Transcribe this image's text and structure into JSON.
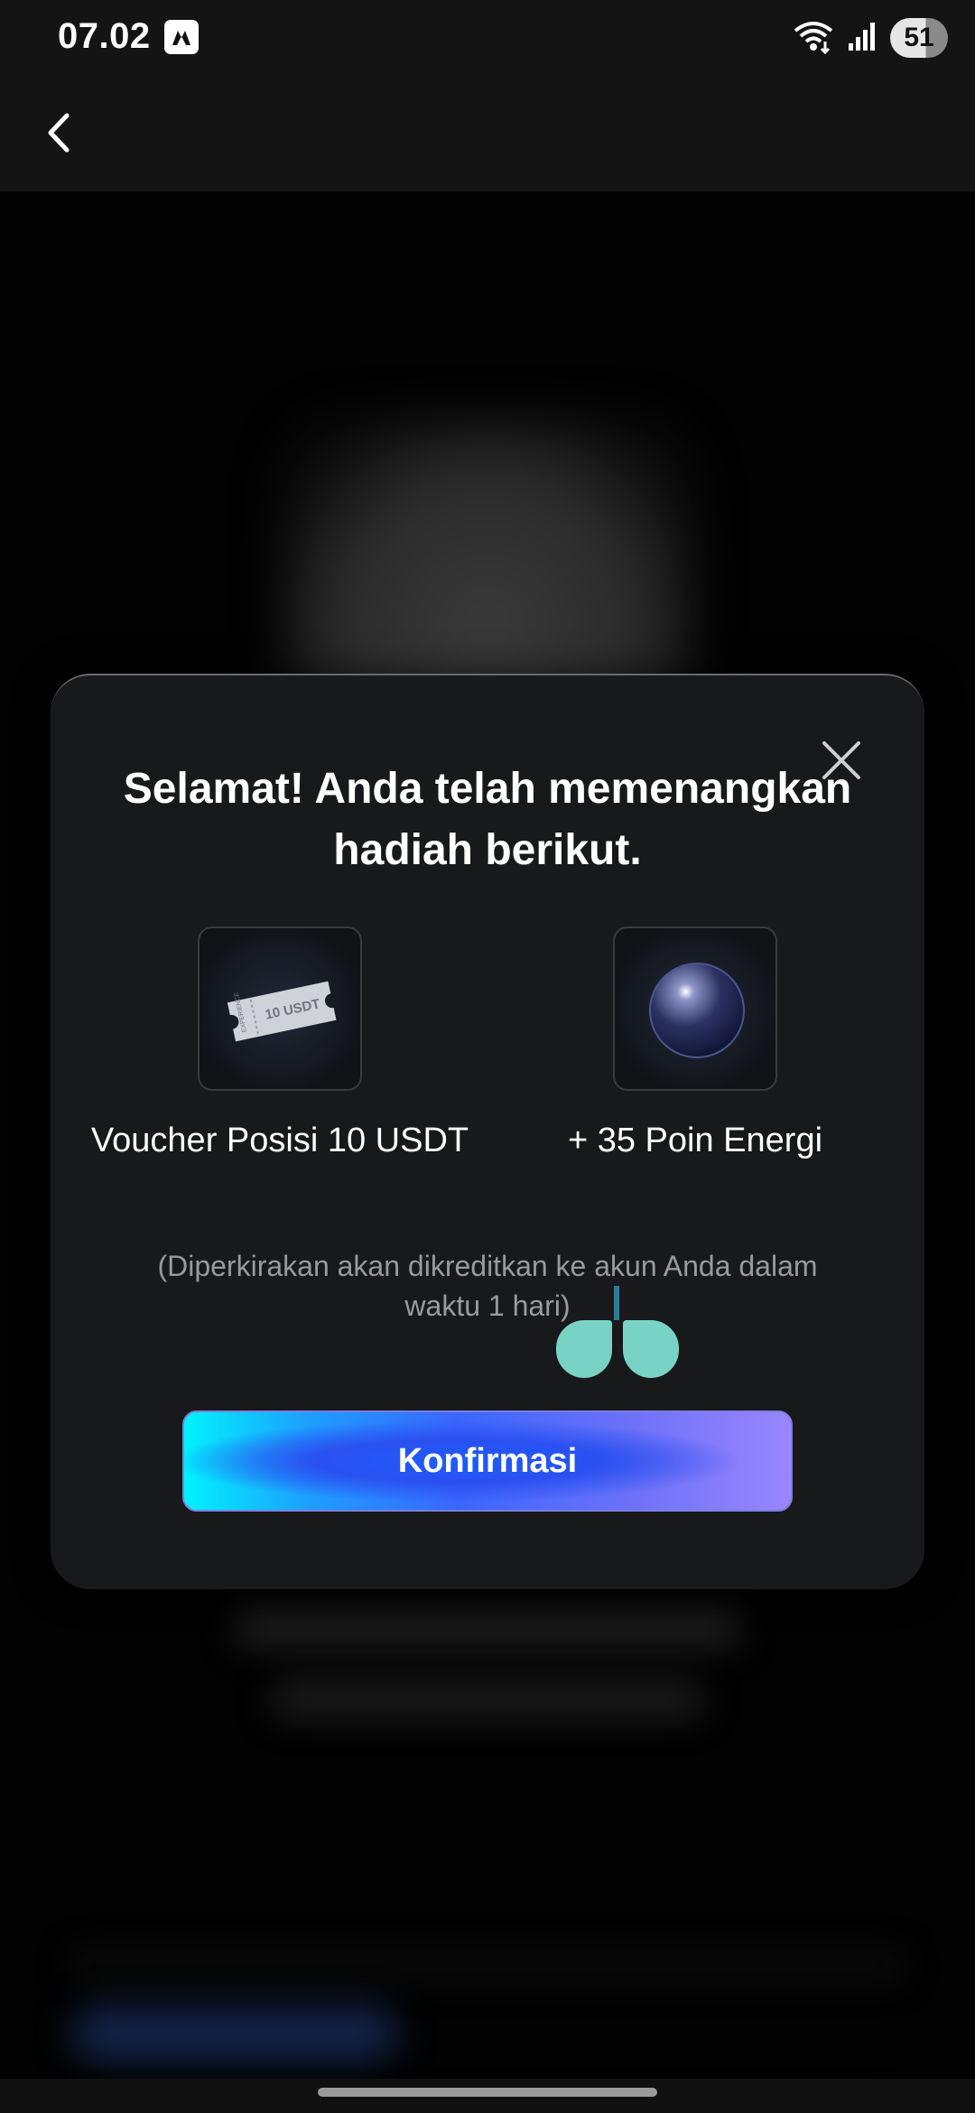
{
  "status_bar": {
    "time": "07.02",
    "battery": "51",
    "icons": [
      "wifi-icon",
      "signal-icon",
      "battery-icon"
    ]
  },
  "header": {
    "back_icon": "chevron-left-icon"
  },
  "modal": {
    "title": "Selamat! Anda telah memenangkan hadiah berikut.",
    "close_icon": "close-icon",
    "rewards": [
      {
        "label": "Voucher Posisi 10 USDT",
        "icon": "voucher-ticket-icon",
        "ticket_text": "10 USDT",
        "ticket_side_text": "EXPERIENCE"
      },
      {
        "label": "+ 35 Poin Energi",
        "icon": "energy-orb-icon"
      }
    ],
    "note": "(Diperkirakan akan dikreditkan ke akun Anda dalam waktu 1 hari)",
    "confirm_label": "Konfirmasi"
  },
  "colors": {
    "modal_bg": "#18191b",
    "button_gradient_start": "#00f2ff",
    "button_gradient_end": "#9a86ff",
    "overlay_teal": "#78d3c6"
  }
}
